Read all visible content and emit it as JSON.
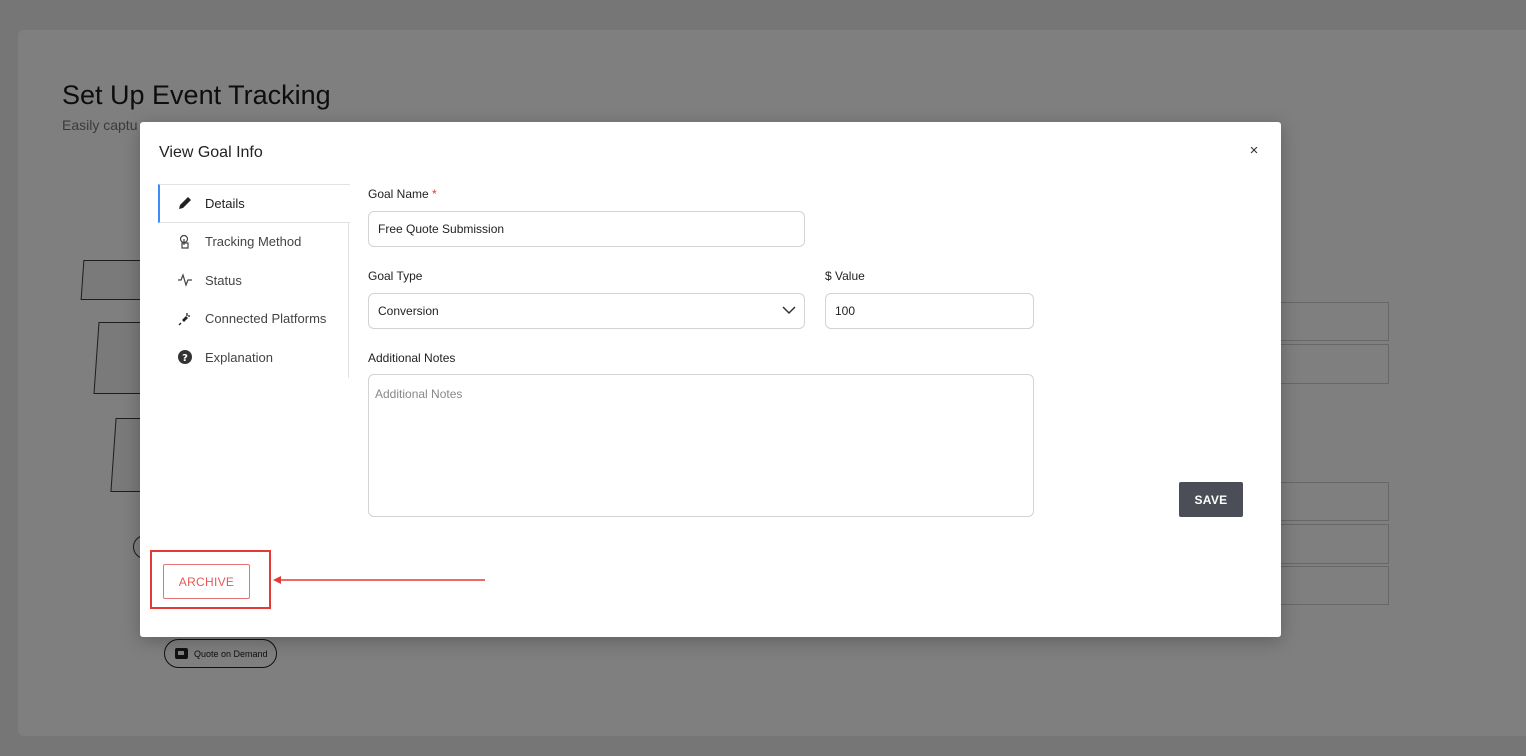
{
  "background": {
    "title": "Set Up Event Tracking",
    "subtitle": "Easily captu",
    "pill_label": "Quote on Demand"
  },
  "modal": {
    "title": "View Goal Info",
    "close_label": "×",
    "nav": [
      {
        "label": "Details",
        "icon": "pencil-icon"
      },
      {
        "label": "Tracking Method",
        "icon": "tap-icon"
      },
      {
        "label": "Status",
        "icon": "pulse-icon"
      },
      {
        "label": "Connected Platforms",
        "icon": "plug-icon"
      },
      {
        "label": "Explanation",
        "icon": "question-icon"
      }
    ],
    "form": {
      "goal_name_label": "Goal Name",
      "required_mark": "*",
      "goal_name_value": "Free Quote Submission",
      "goal_type_label": "Goal Type",
      "goal_type_value": "Conversion",
      "value_label": "$ Value",
      "value_value": "100",
      "notes_label": "Additional Notes",
      "notes_placeholder": "Additional Notes"
    },
    "save_label": "SAVE",
    "archive_label": "ARCHIVE"
  },
  "colors": {
    "highlight": "#e53935",
    "active_tab": "#3d8bfd",
    "save_bg": "#4b4e57"
  }
}
